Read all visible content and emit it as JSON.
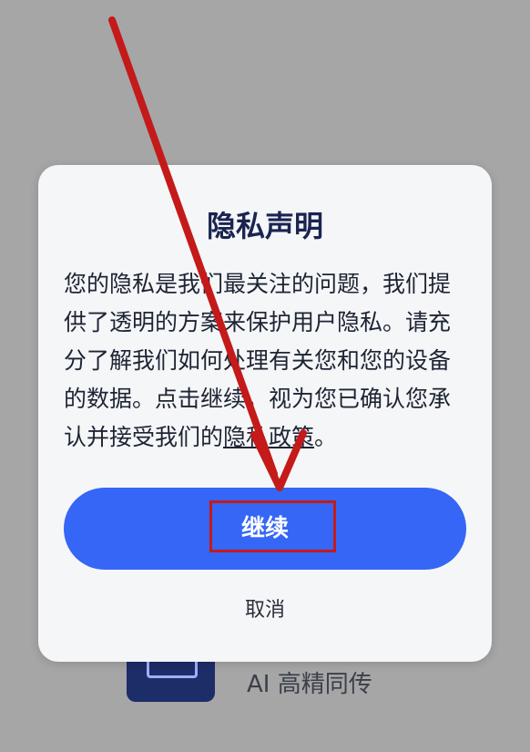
{
  "background_app": {
    "label": "AI 高精同传",
    "icon": "interpreter-app-icon"
  },
  "dialog": {
    "title": "隐私声明",
    "body_text": "您的隐私是我们最关注的问题，我们提供了透明的方案来保护用户隐私。请充分了解我们如何处理有关您和您的设备的数据。点击继续，视为您已确认您承认并接受我们的",
    "privacy_link": "隐私政策",
    "body_end": "。",
    "continue_label": "继续",
    "cancel_label": "取消"
  },
  "annotation": {
    "arrow_color": "#c41a1a",
    "highlight_color": "#c41a1a",
    "target": "继续"
  },
  "colors": {
    "accent": "#3566f5",
    "overlay": "#a6a6a6",
    "dialog_bg": "#f5f6f8"
  }
}
